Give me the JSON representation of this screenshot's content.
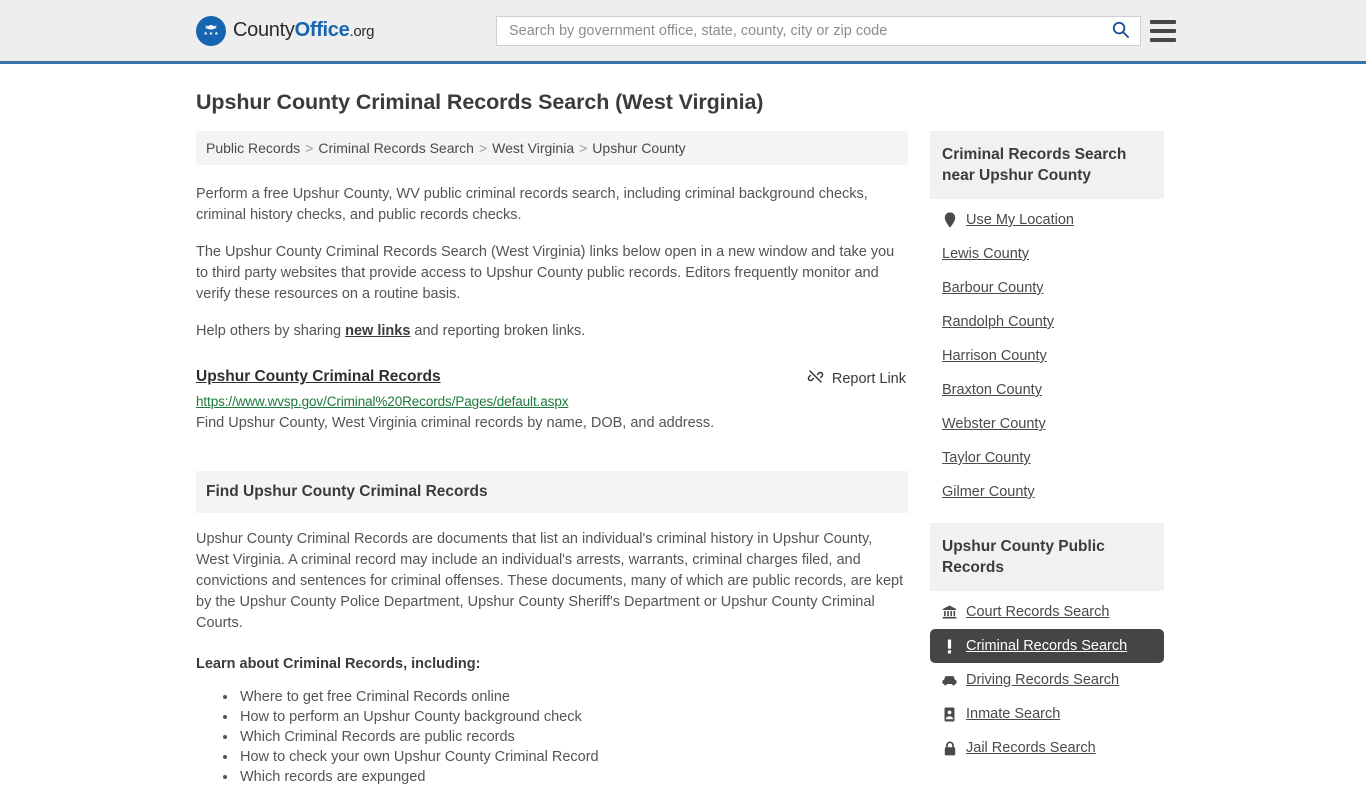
{
  "header": {
    "brand": {
      "part1": "County",
      "part2": "Office",
      "part3": ".org",
      "icon": "eagle-seal-icon"
    },
    "search": {
      "placeholder": "Search by government office, state, county, city or zip code",
      "value": "",
      "icon": "search-icon"
    },
    "menu_icon": "hamburger-menu-icon",
    "accent_color": "#3a75a8"
  },
  "page": {
    "title": "Upshur County Criminal Records Search (West Virginia)"
  },
  "breadcrumb": {
    "items": [
      {
        "label": "Public Records"
      },
      {
        "label": "Criminal Records Search"
      },
      {
        "label": "West Virginia"
      },
      {
        "label": "Upshur County"
      }
    ],
    "separator": ">"
  },
  "intro": {
    "p1": "Perform a free Upshur County, WV public criminal records search, including criminal background checks, criminal history checks, and public records checks.",
    "p2": "The Upshur County Criminal Records Search (West Virginia) links below open in a new window and take you to third party websites that provide access to Upshur County public records. Editors frequently monitor and verify these resources on a routine basis.",
    "p3_before": "Help others by sharing ",
    "p3_link": "new links",
    "p3_after": " and reporting broken links."
  },
  "result": {
    "title": "Upshur County Criminal Records",
    "url": "https://www.wvsp.gov/Criminal%20Records/Pages/default.aspx",
    "description": "Find Upshur County, West Virginia criminal records by name, DOB, and address.",
    "report_label": "Report Link",
    "report_icon": "broken-link-icon",
    "url_color": "#1d7a3c"
  },
  "section": {
    "banner": "Find Upshur County Criminal Records",
    "body": "Upshur County Criminal Records are documents that list an individual's criminal history in Upshur County, West Virginia. A criminal record may include an individual's arrests, warrants, criminal charges filed, and convictions and sentences for criminal offenses. These documents, many of which are public records, are kept by the Upshur County Police Department, Upshur County Sheriff's Department or Upshur County Criminal Courts.",
    "lead_in": "Learn about Criminal Records, including:",
    "bullets": [
      "Where to get free Criminal Records online",
      "How to perform an Upshur County background check",
      "Which Criminal Records are public records",
      "How to check your own Upshur County Criminal Record",
      "Which records are expunged"
    ]
  },
  "sidebar": {
    "nearby": {
      "heading": "Criminal Records Search near Upshur County",
      "items": [
        {
          "label": "Use My Location",
          "icon": "map-pin-icon"
        },
        {
          "label": "Lewis County",
          "icon": ""
        },
        {
          "label": "Barbour County",
          "icon": ""
        },
        {
          "label": "Randolph County",
          "icon": ""
        },
        {
          "label": "Harrison County",
          "icon": ""
        },
        {
          "label": "Braxton County",
          "icon": ""
        },
        {
          "label": "Webster County",
          "icon": ""
        },
        {
          "label": "Taylor County",
          "icon": ""
        },
        {
          "label": "Gilmer County",
          "icon": ""
        }
      ]
    },
    "public_records": {
      "heading": "Upshur County Public Records",
      "active_color": "#454545",
      "items": [
        {
          "label": "Court Records Search",
          "icon": "courthouse-icon",
          "active": false
        },
        {
          "label": "Criminal Records Search",
          "icon": "exclamation-icon",
          "active": true
        },
        {
          "label": "Driving Records Search",
          "icon": "car-icon",
          "active": false
        },
        {
          "label": "Inmate Search",
          "icon": "id-badge-icon",
          "active": false
        },
        {
          "label": "Jail Records Search",
          "icon": "lock-icon",
          "active": false
        }
      ]
    }
  }
}
